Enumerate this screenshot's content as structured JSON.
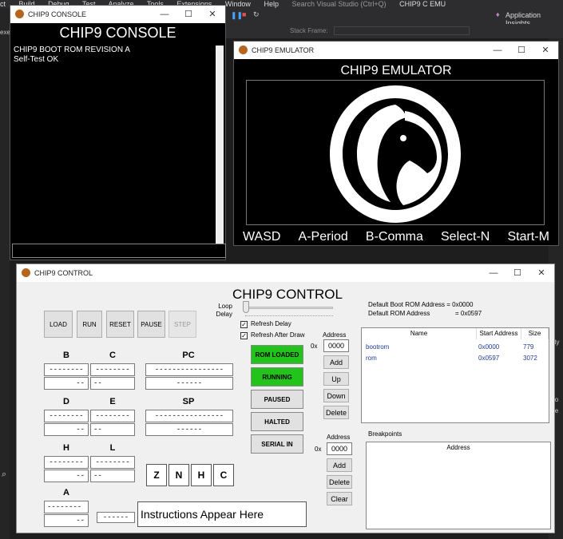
{
  "vs": {
    "menu": [
      "ct",
      "Build",
      "Debug",
      "Test",
      "Analyze",
      "Tools",
      "Extensions",
      "Window",
      "Help"
    ],
    "search_placeholder": "Search Visual Studio (Ctrl+Q)",
    "solution": "CHIP9 C EMU",
    "app_insights": "Application Insights",
    "stack_frame": "Stack Frame:",
    "side_labels": [
      "Sty",
      "Co",
      "De"
    ],
    "left_label": "exe"
  },
  "console": {
    "title": "CHIP9 CONSOLE",
    "heading": "CHIP9 CONSOLE",
    "lines": [
      "CHIP9 BOOT ROM REVISION A",
      "Self-Test OK"
    ],
    "input_value": ""
  },
  "emulator": {
    "title": "CHIP9 EMULATOR",
    "heading": "CHIP9 EMULATOR",
    "keys": [
      "WASD",
      "A-Period",
      "B-Comma",
      "Select-N",
      "Start-M"
    ]
  },
  "control": {
    "title": "CHIP9 CONTROL",
    "heading": "CHIP9 CONTROL",
    "buttons": {
      "load": "LOAD",
      "run": "RUN",
      "reset": "RESET",
      "pause": "PAUSE",
      "step": "STEP"
    },
    "loop_delay_label": "Loop Delay",
    "loop_delay_value": 0,
    "refresh_delay": "Refresh Delay",
    "refresh_after_draw": "Refresh After Draw",
    "registers": {
      "b": "B",
      "c": "C",
      "pc": "PC",
      "d": "D",
      "e": "E",
      "sp": "SP",
      "h": "H",
      "l": "L",
      "a": "A",
      "bit8": "--------",
      "hex2": "--",
      "bit16": "----------------",
      "hex4": "------",
      "hex_wide": "------"
    },
    "states": [
      {
        "label": "ROM LOADED",
        "active": true
      },
      {
        "label": "RUNNING",
        "active": true
      },
      {
        "label": "PAUSED",
        "active": false
      },
      {
        "label": "HALTED",
        "active": false
      },
      {
        "label": "SERIAL IN",
        "active": false
      }
    ],
    "flags": [
      "Z",
      "N",
      "H",
      "C"
    ],
    "instructions": "Instructions Appear Here",
    "mem": {
      "address_label": "Address",
      "prefix": "0x",
      "address_value": "0000",
      "add": "Add",
      "up": "Up",
      "down": "Down",
      "delete": "Delete"
    },
    "bp": {
      "address_label": "Address",
      "prefix": "0x",
      "address_value": "0000",
      "add": "Add",
      "delete": "Delete",
      "clear": "Clear",
      "title": "Breakpoints",
      "column": "Address"
    },
    "defaults": {
      "boot_label": "Default Boot ROM Address = 0x0000",
      "rom_label": "Default ROM Address",
      "rom_value": "= 0x0597"
    },
    "rom_table": {
      "columns": [
        "Name",
        "Start Address",
        "Size"
      ],
      "rows": [
        {
          "name": "bootrom",
          "start": "0x0000",
          "size": "779"
        },
        {
          "name": "rom",
          "start": "0x0597",
          "size": "3072"
        }
      ]
    }
  },
  "colors": {
    "active_green": "#22c31b",
    "accent_purple": "#c586c0"
  }
}
